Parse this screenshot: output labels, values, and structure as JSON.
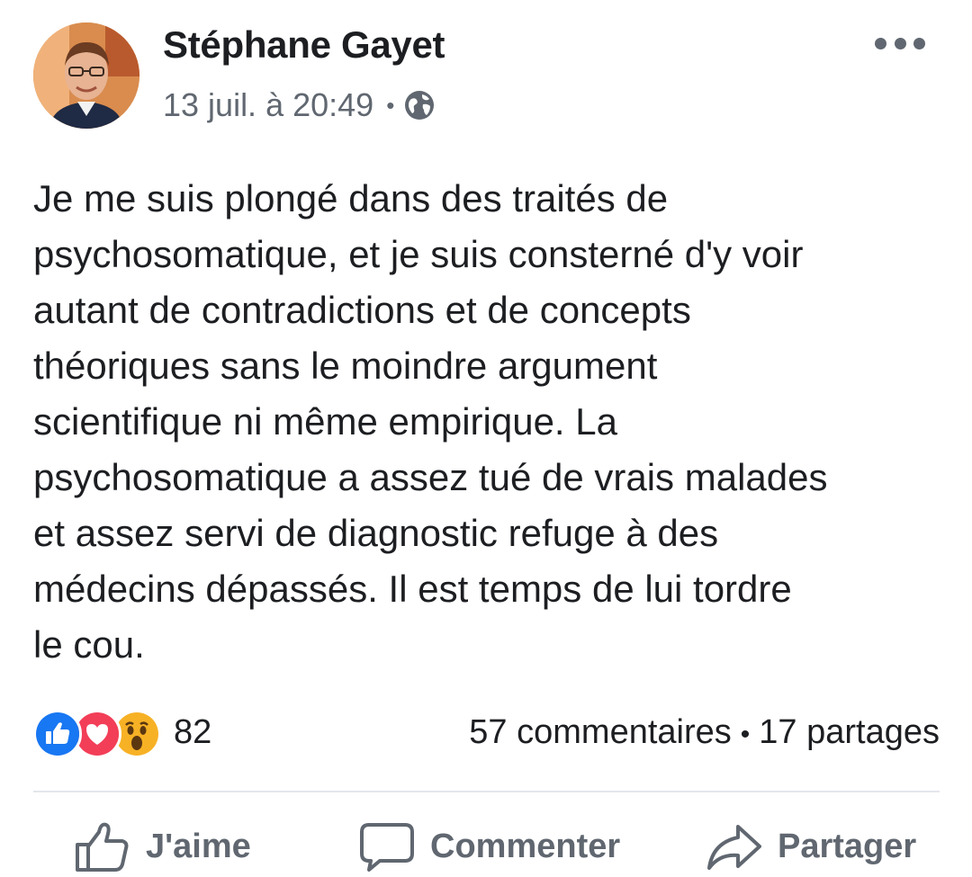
{
  "post": {
    "author": "Stéphane Gayet",
    "timestamp": "13 juil. à 20:49",
    "separator": "•",
    "privacy_icon": "globe-icon",
    "body_lines": [
      "Je me suis plongé dans des traités de",
      "psychosomatique, et je suis consterné d'y voir",
      "autant de contradictions et de concepts",
      "théoriques sans le moindre argument",
      "scientifique ni même empirique. La",
      "psychosomatique a assez tué de vrais malades",
      "et assez servi de diagnostic refuge à des",
      "médecins dépassés. Il est temps de lui tordre",
      "le cou."
    ]
  },
  "stats": {
    "reactions": [
      "like",
      "love",
      "wow"
    ],
    "reaction_count": "82",
    "comments": "57 commentaires",
    "separator": "•",
    "shares": "17 partages"
  },
  "actions": {
    "like": "J'aime",
    "comment": "Commenter",
    "share": "Partager"
  },
  "colors": {
    "like_blue": "#1877f2",
    "love_red": "#f33e58",
    "wow_yellow": "#f7b125",
    "secondary_text": "#606770"
  }
}
